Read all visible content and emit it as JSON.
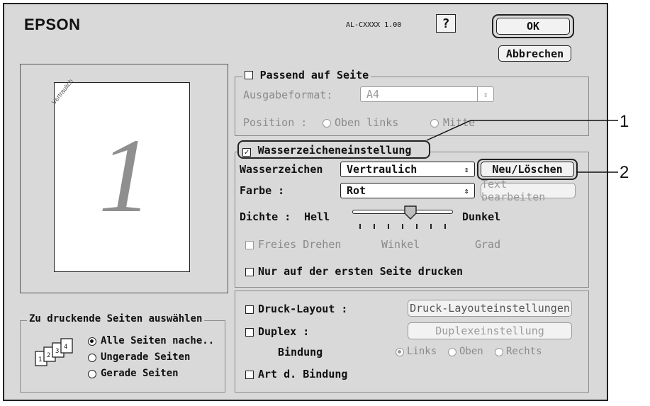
{
  "header": {
    "brand": "EPSON",
    "model": "AL-CXXXX 1.00",
    "help": "?",
    "ok": "OK",
    "cancel": "Abbrechen"
  },
  "preview": {
    "watermark": "Vertraulich",
    "page_number": "1"
  },
  "fit": {
    "label": "Passend auf Seite",
    "format_label": "Ausgabeformat:",
    "format_value": "A4",
    "position_label": "Position :",
    "pos_top_left": "Oben links",
    "pos_center": "Mitte"
  },
  "watermark": {
    "group_label": "Wasserzeicheneinstellung",
    "wm_label": "Wasserzeichen",
    "wm_value": "Vertraulich",
    "new_delete": "Neu/Löschen",
    "color_label": "Farbe :",
    "color_value": "Rot",
    "edit_text": "Text bearbeiten",
    "density_label": "Dichte :",
    "light": "Hell",
    "dark": "Dunkel",
    "density_level": 0.6,
    "free_rotate": "Freies Drehen",
    "angle": "Winkel",
    "degree": "Grad",
    "first_page_only": "Nur auf der ersten Seite drucken"
  },
  "layout": {
    "print_layout": "Druck-Layout :",
    "print_layout_btn": "Druck-Layouteinstellungen",
    "duplex": "Duplex :",
    "duplex_btn": "Duplexeinstellung",
    "binding_label": "Bindung",
    "bind_left": "Links",
    "bind_top": "Oben",
    "bind_right": "Rechts",
    "binding_type": "Art d. Bindung"
  },
  "pages": {
    "title": "Zu druckende Seiten auswählen",
    "all": "Alle Seiten nache..",
    "odd": "Ungerade Seiten",
    "even": "Gerade Seiten"
  },
  "callouts": {
    "one": "1",
    "two": "2"
  }
}
